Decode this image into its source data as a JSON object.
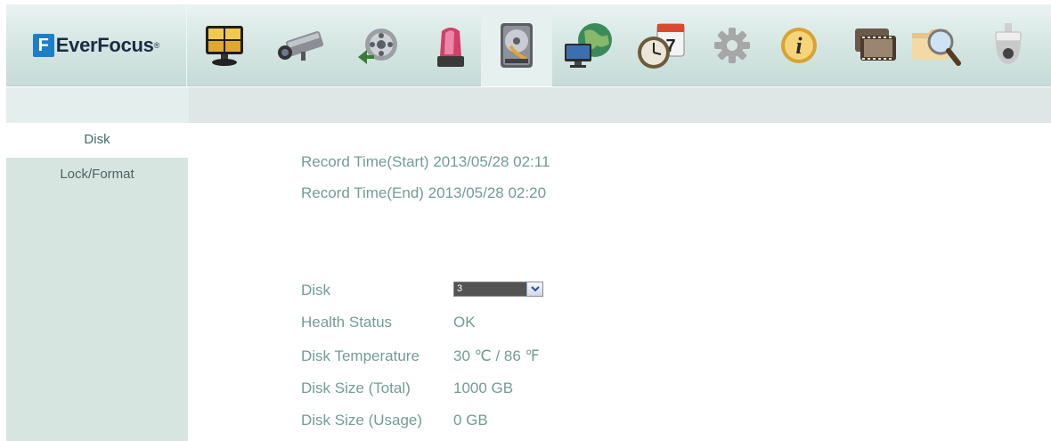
{
  "brand": {
    "logo_letter": "F",
    "name": "EverFocus",
    "registered": "®"
  },
  "toolbar": {
    "icons": [
      {
        "name": "live-view-icon"
      },
      {
        "name": "camera-icon"
      },
      {
        "name": "record-icon"
      },
      {
        "name": "alarm-icon"
      },
      {
        "name": "disk-icon",
        "active": true
      },
      {
        "name": "network-icon"
      },
      {
        "name": "schedule-icon"
      },
      {
        "name": "settings-icon"
      },
      {
        "name": "info-icon"
      },
      {
        "name": "playback-icon"
      },
      {
        "name": "search-icon"
      },
      {
        "name": "ptz-dome-icon"
      }
    ],
    "calendar_day": "7",
    "info_glyph": "i"
  },
  "sidebar": {
    "items": [
      {
        "label": "Disk",
        "active": true
      },
      {
        "label": "Lock/Format",
        "active": false
      }
    ]
  },
  "record": {
    "start_label": "Record Time(Start)",
    "start_value": "2013/05/28 02:11",
    "end_label": "Record Time(End)",
    "end_value": "2013/05/28 02:20"
  },
  "disk": {
    "select_label": "Disk",
    "selected": "3",
    "health_label": "Health Status",
    "health_value": "OK",
    "temp_label": "Disk Temperature",
    "temp_value": "30 ℃ / 86 ℉",
    "size_total_label": "Disk Size (Total)",
    "size_total_value": "1000 GB",
    "size_usage_label": "Disk Size (Usage)",
    "size_usage_value": "0 GB"
  },
  "colors": {
    "label_text": "#739c93",
    "sidebar_bg": "#d7e5e1",
    "topbar_bg": "#d3e5e1",
    "logo_blue": "#1d7fc7"
  }
}
